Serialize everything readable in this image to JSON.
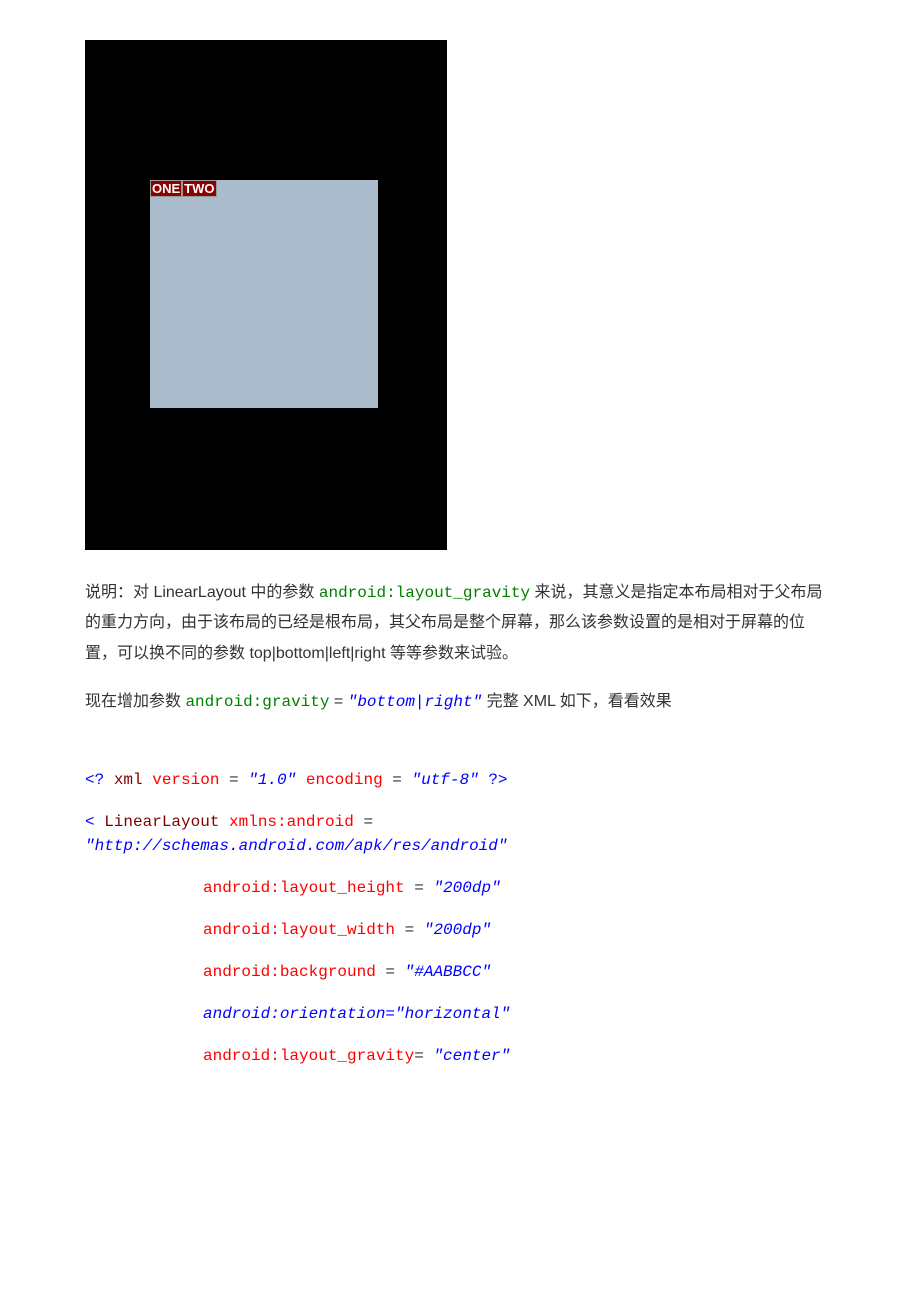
{
  "screenshot": {
    "label_one": "ONE",
    "label_two": "TWO"
  },
  "para1": {
    "pre": "说明：对 LinearLayout 中的参数 ",
    "code": "android:layout_gravity",
    "post": " 来说，其意义是指定本布局相对于父布局的重力方向，由于该布局的已经是根布局，其父布局是整个屏幕，那么该参数设置的是相对于屏幕的位置，可以换不同的参数 top|bottom|left|right 等等参数来试验。"
  },
  "para2": {
    "pre": "现在增加参数 ",
    "code1": "android:gravity",
    "eq": " = ",
    "val": "\"bottom|right\"",
    "post": " 完整 XML 如下，看看效果"
  },
  "xml": {
    "decl_pre": "<? ",
    "decl_xml": "xml",
    "decl_version_attr": " version",
    "decl_eq": " = ",
    "decl_version_val": "\"1.0\"",
    "decl_enc_attr": " encoding",
    "decl_enc_val": "\"utf-8\"",
    "decl_post": " ?>",
    "ll_open": "< ",
    "ll_name": "LinearLayout",
    "ll_ns_attr": " xmlns:android",
    "ll_ns_val": "\"http://schemas.android.com/apk/res/android\"",
    "h_attr": "android:layout_height",
    "h_val": "\"200dp\"",
    "w_attr": "android:layout_width",
    "w_val": "\"200dp\"",
    "bg_attr": "android:background",
    "bg_val": "\"#AABBCC\"",
    "ori": "android:orientation=\"horizontal\"",
    "lg_attr": "android:layout_gravity",
    "lg_eq": "= ",
    "lg_val": "\"center\""
  }
}
